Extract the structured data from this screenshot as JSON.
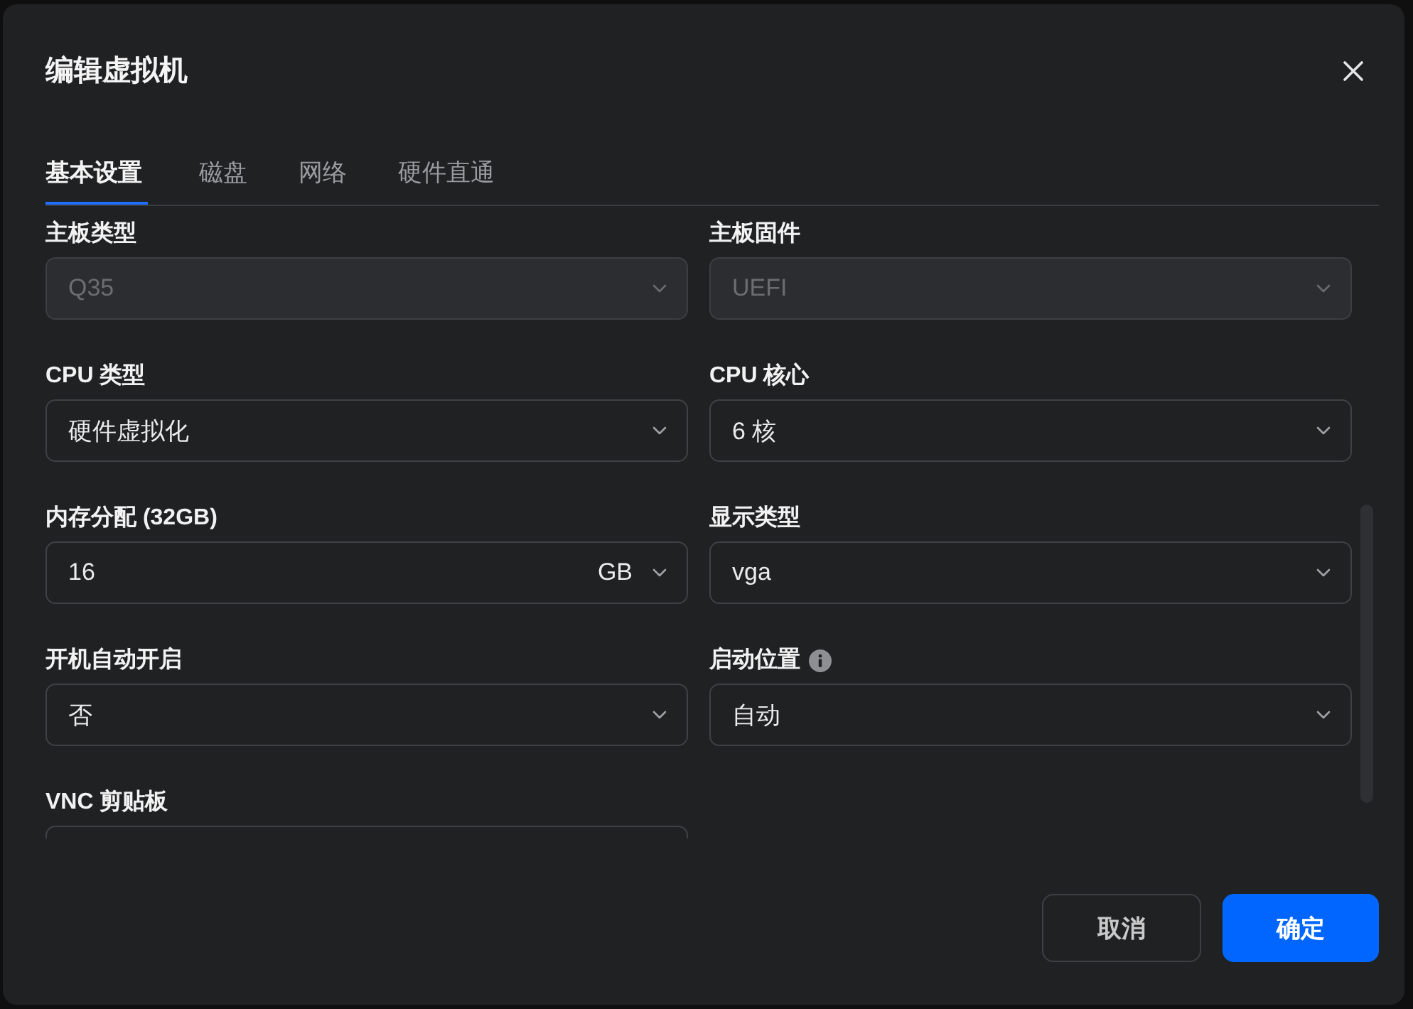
{
  "dialog": {
    "title": "编辑虚拟机"
  },
  "tabs": [
    {
      "label": "基本设置",
      "selected": true
    },
    {
      "label": "磁盘",
      "selected": false
    },
    {
      "label": "网络",
      "selected": false
    },
    {
      "label": "硬件直通",
      "selected": false
    }
  ],
  "fields": [
    {
      "label": "主板类型",
      "kind": "select",
      "value": "Q35",
      "disabled": true,
      "info": false
    },
    {
      "label": "主板固件",
      "kind": "select",
      "value": "UEFI",
      "disabled": true,
      "info": false
    },
    {
      "label": "CPU 类型",
      "kind": "select",
      "value": "硬件虚拟化",
      "disabled": false,
      "info": false
    },
    {
      "label": "CPU 核心",
      "kind": "select",
      "value": "6 核",
      "disabled": false,
      "info": false
    },
    {
      "label": "内存分配 (32GB)",
      "kind": "number",
      "value": "16",
      "unit": "GB",
      "disabled": false,
      "info": false
    },
    {
      "label": "显示类型",
      "kind": "select",
      "value": "vga",
      "disabled": false,
      "info": false
    },
    {
      "label": "开机自动开启",
      "kind": "select",
      "value": "否",
      "disabled": false,
      "info": false
    },
    {
      "label": "启动位置",
      "kind": "select",
      "value": "自动",
      "disabled": false,
      "info": true
    },
    {
      "label": "VNC 剪贴板",
      "kind": "select",
      "disabled": false,
      "info": false
    }
  ],
  "buttons": [
    {
      "label": "取消",
      "kind": "secondary"
    },
    {
      "label": "确定",
      "kind": "primary"
    }
  ]
}
